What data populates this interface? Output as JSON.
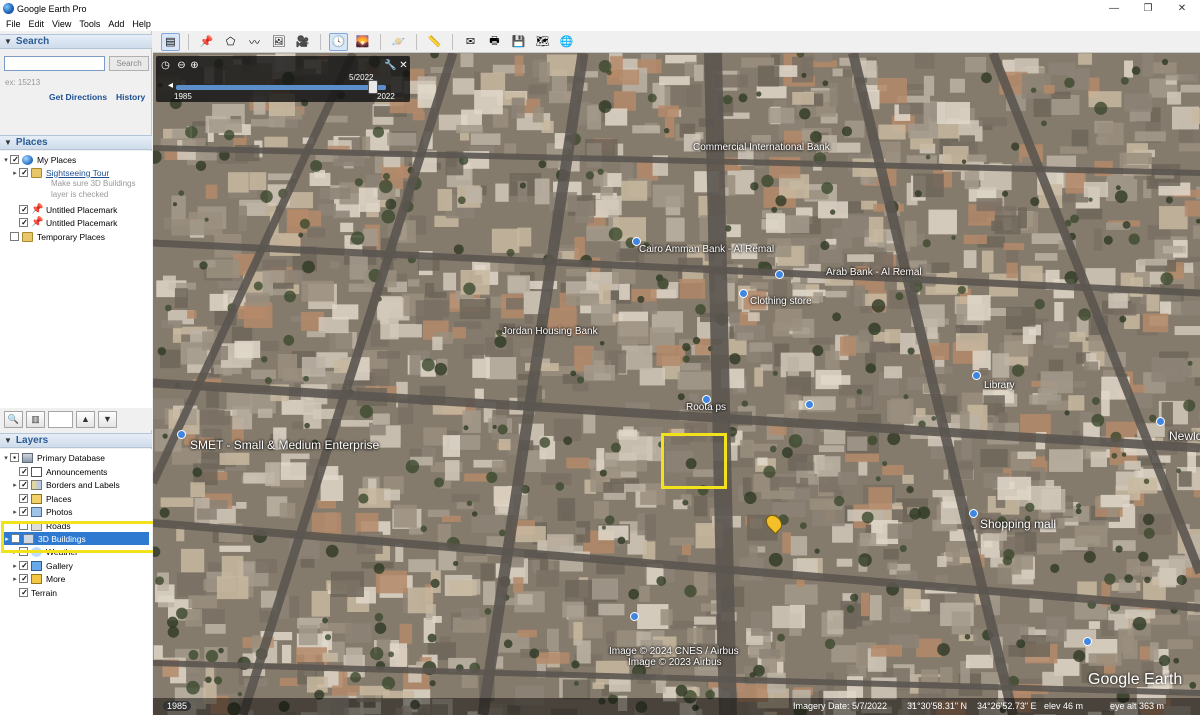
{
  "window": {
    "title": "Google Earth Pro"
  },
  "menu": [
    "File",
    "Edit",
    "View",
    "Tools",
    "Add",
    "Help"
  ],
  "search": {
    "header": "Search",
    "button": "Search",
    "example": "ex: 15213",
    "get_directions": "Get Directions",
    "history": "History"
  },
  "places": {
    "header": "Places",
    "items": [
      {
        "label": "My Places"
      },
      {
        "label": "Sightseeing Tour",
        "sub1": "Make sure 3D Buildings",
        "sub2": "layer is checked"
      },
      {
        "label": "Untitled Placemark"
      },
      {
        "label": "Untitled Placemark"
      },
      {
        "label": "Temporary Places"
      }
    ]
  },
  "layers": {
    "header": "Layers",
    "items": [
      {
        "label": "Primary Database"
      },
      {
        "label": "Announcements"
      },
      {
        "label": "Borders and Labels"
      },
      {
        "label": "Places"
      },
      {
        "label": "Photos"
      },
      {
        "label": "Roads"
      },
      {
        "label": "3D Buildings"
      },
      {
        "label": "Weather"
      },
      {
        "label": "Gallery"
      },
      {
        "label": "More"
      },
      {
        "label": "Terrain"
      }
    ]
  },
  "timeslider": {
    "date": "5/2022",
    "start_year": "1985",
    "end_year": "2022"
  },
  "map_labels": [
    "Commercial International Bank",
    "Cairo Amman Bank - Al Remal",
    "Arab Bank - Al Remal",
    "Clothing store",
    "Jordan Housing Bank",
    "Roota ps",
    "SMET - Small & Medium Enterprise",
    "Shopping mall",
    "Library",
    "Newlook",
    "Image © 2024 CNES / Airbus",
    "Image © 2023 Airbus"
  ],
  "status": {
    "year_chip": "1985",
    "imagery_date": "Imagery Date: 5/7/2022",
    "lat": "31°30'58.31\" N",
    "lon": "34°26'52.73\" E",
    "elev": "elev   46 m",
    "eye_alt": "eye alt   363 m"
  },
  "watermark": "Google Earth"
}
